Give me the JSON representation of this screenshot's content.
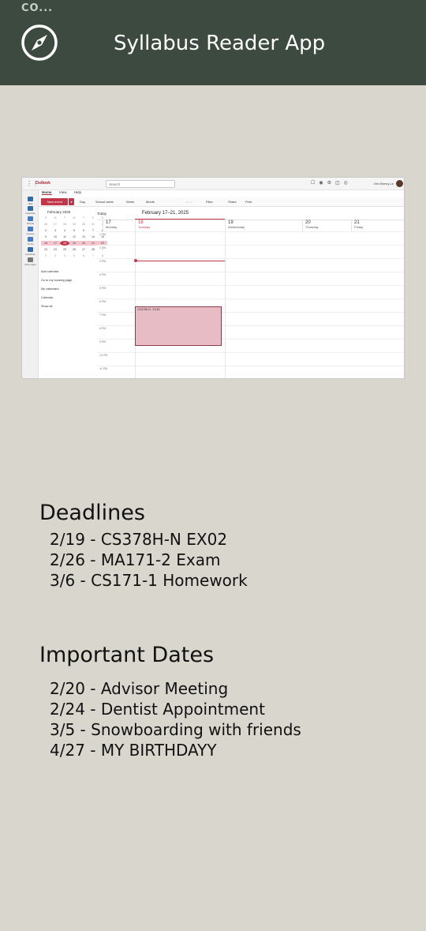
{
  "status": {
    "text": "CO..."
  },
  "app": {
    "title": "Syllabus Reader App",
    "logo_icon": "compass-icon"
  },
  "screenshot": {
    "brand": "Outlook",
    "search_placeholder": "Search",
    "user_name": "Kim Beeny-Le",
    "tabs": [
      "Home",
      "View",
      "Help"
    ],
    "ribbon": {
      "new_event": "New event",
      "day": "Day",
      "school_week": "School week",
      "week": "Week",
      "month": "Month",
      "filter": "Filter",
      "share": "Share",
      "print": "Print"
    },
    "rail": [
      "Mail",
      "Calendar",
      "People",
      "Groups",
      "To Do",
      "OneDrive",
      "More apps"
    ],
    "mini_calendar": {
      "title": "February 2025",
      "weekdays": [
        "S",
        "M",
        "T",
        "W",
        "T",
        "F",
        "S"
      ],
      "days": [
        "26",
        "27",
        "28",
        "29",
        "30",
        "31",
        "1",
        "2",
        "3",
        "4",
        "5",
        "6",
        "7",
        "8",
        "9",
        "10",
        "11",
        "12",
        "13",
        "14",
        "15",
        "16",
        "17",
        "18",
        "19",
        "20",
        "21",
        "22",
        "23",
        "24",
        "25",
        "26",
        "27",
        "28",
        "1",
        "2",
        "3",
        "4",
        "5",
        "6",
        "7",
        "8"
      ]
    },
    "side_links": {
      "add_calendar": "Add calendar",
      "booking": "Go to my booking page",
      "my_calendars": "My calendars",
      "calendar": "Calendar",
      "show_all": "Show all"
    },
    "today_label": "Today",
    "date_range": "February 17–21, 2025",
    "days": [
      {
        "num": "17",
        "name": "Monday"
      },
      {
        "num": "18",
        "name": "Tuesday"
      },
      {
        "num": "19",
        "name": "Wednesday"
      },
      {
        "num": "20",
        "name": "Thursday"
      },
      {
        "num": "21",
        "name": "Friday"
      }
    ],
    "hours": [
      "1 PM",
      "2 PM",
      "3 PM",
      "4 PM",
      "5 PM",
      "6 PM",
      "7 PM",
      "8 PM",
      "9 PM",
      "10 PM",
      "11 PM"
    ],
    "event_title": "CS378H-N - EX02"
  },
  "deadlines": {
    "title": "Deadlines",
    "items": [
      "2/19 - CS378H-N EX02",
      "2/26 - MA171-2 Exam",
      "3/6 - CS171-1 Homework"
    ]
  },
  "important_dates": {
    "title": "Important Dates",
    "items": [
      "2/20 - Advisor Meeting",
      "2/24 - Dentist Appointment",
      "3/5 - Snowboarding with friends",
      "4/27 - MY BIRTHDAYY"
    ]
  }
}
